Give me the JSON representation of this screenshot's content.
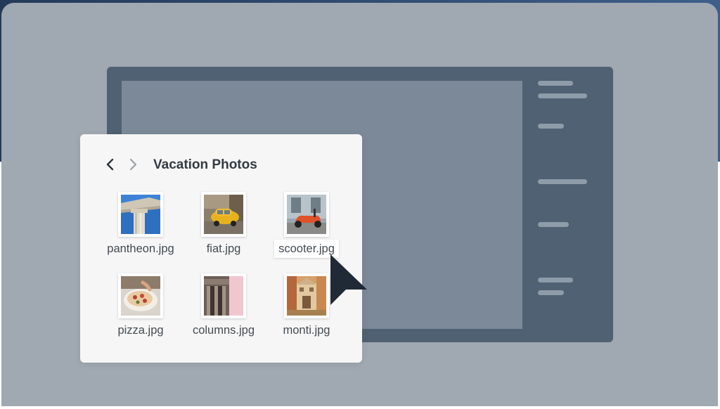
{
  "panel": {
    "title": "Vacation Photos",
    "back_icon": "chevron-left-icon",
    "forward_icon": "chevron-right-icon"
  },
  "files": [
    {
      "name": "pantheon.jpg",
      "thumbnail": "pantheon-column-photo",
      "selected": false
    },
    {
      "name": "fiat.jpg",
      "thumbnail": "yellow-car-photo",
      "selected": false
    },
    {
      "name": "scooter.jpg",
      "thumbnail": "red-scooter-photo",
      "selected": true
    },
    {
      "name": "pizza.jpg",
      "thumbnail": "pizza-photo",
      "selected": false
    },
    {
      "name": "columns.jpg",
      "thumbnail": "columns-photo",
      "selected": false
    },
    {
      "name": "monti.jpg",
      "thumbnail": "building-photo",
      "selected": false
    }
  ],
  "cursor_icon": "mouse-pointer-icon",
  "colors": {
    "backdrop": "#a0a8b1",
    "app_window": "#4f6172",
    "app_canvas": "#7b8998",
    "panel": "#f6f6f6",
    "cursor": "#1f2a36"
  }
}
